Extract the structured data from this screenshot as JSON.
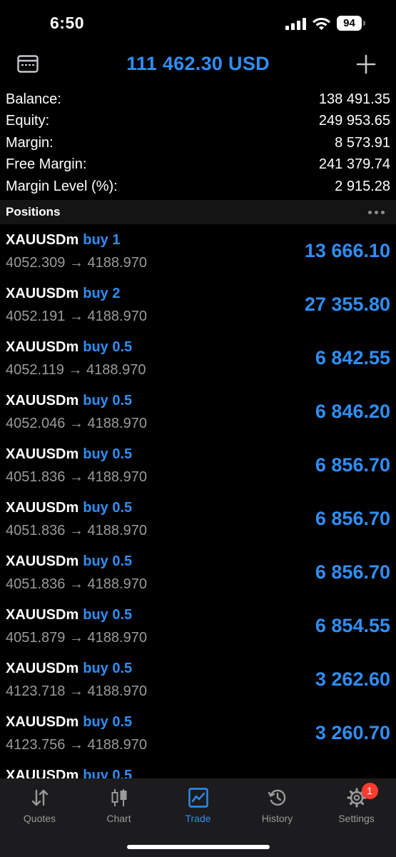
{
  "status_bar": {
    "time": "6:50",
    "battery": "94"
  },
  "header": {
    "title": "111 462.30 USD"
  },
  "summary": [
    {
      "label": "Balance:",
      "value": "138 491.35"
    },
    {
      "label": "Equity:",
      "value": "249 953.65"
    },
    {
      "label": "Margin:",
      "value": "8 573.91"
    },
    {
      "label": "Free Margin:",
      "value": "241 379.74"
    },
    {
      "label": "Margin Level (%):",
      "value": "2 915.28"
    }
  ],
  "positions_section": {
    "title": "Positions"
  },
  "positions": [
    {
      "symbol": "XAUUSDm",
      "type": "buy 1",
      "prices": "4052.309 → 4188.970",
      "profit": "13 666.10"
    },
    {
      "symbol": "XAUUSDm",
      "type": "buy 2",
      "prices": "4052.191 → 4188.970",
      "profit": "27 355.80"
    },
    {
      "symbol": "XAUUSDm",
      "type": "buy 0.5",
      "prices": "4052.119 → 4188.970",
      "profit": "6 842.55"
    },
    {
      "symbol": "XAUUSDm",
      "type": "buy 0.5",
      "prices": "4052.046 → 4188.970",
      "profit": "6 846.20"
    },
    {
      "symbol": "XAUUSDm",
      "type": "buy 0.5",
      "prices": "4051.836 → 4188.970",
      "profit": "6 856.70"
    },
    {
      "symbol": "XAUUSDm",
      "type": "buy 0.5",
      "prices": "4051.836 → 4188.970",
      "profit": "6 856.70"
    },
    {
      "symbol": "XAUUSDm",
      "type": "buy 0.5",
      "prices": "4051.836 → 4188.970",
      "profit": "6 856.70"
    },
    {
      "symbol": "XAUUSDm",
      "type": "buy 0.5",
      "prices": "4051.879 → 4188.970",
      "profit": "6 854.55"
    },
    {
      "symbol": "XAUUSDm",
      "type": "buy 0.5",
      "prices": "4123.718 → 4188.970",
      "profit": "3 262.60"
    },
    {
      "symbol": "XAUUSDm",
      "type": "buy 0.5",
      "prices": "4123.756 → 4188.970",
      "profit": "3 260.70"
    },
    {
      "symbol": "XAUUSDm",
      "type": "buy 0.5",
      "prices": "",
      "profit": ""
    }
  ],
  "tabs": [
    {
      "label": "Quotes",
      "icon": "quotes-icon",
      "active": false
    },
    {
      "label": "Chart",
      "icon": "chart-icon",
      "active": false
    },
    {
      "label": "Trade",
      "icon": "trade-icon",
      "active": true
    },
    {
      "label": "History",
      "icon": "history-icon",
      "active": false
    },
    {
      "label": "Settings",
      "icon": "settings-icon",
      "active": false,
      "badge": "1"
    }
  ],
  "colors": {
    "accent": "#2f8ef4",
    "background": "#000000",
    "tab_bar": "#1c1c1e",
    "badge": "#ff3b30"
  }
}
